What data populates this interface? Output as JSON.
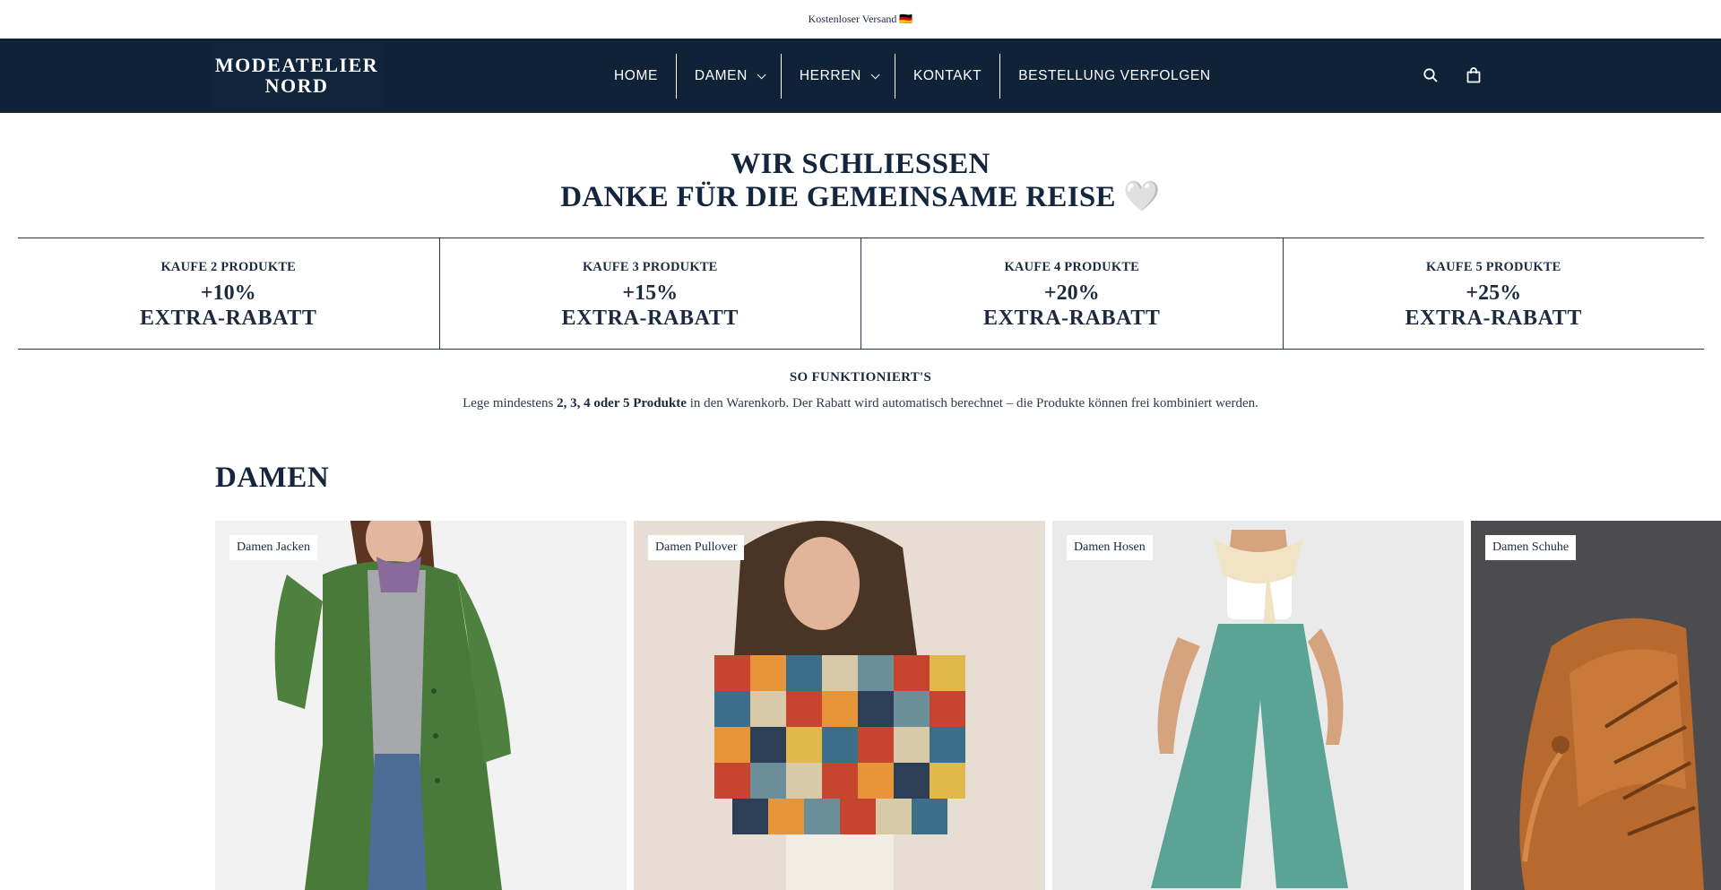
{
  "announcement": "Kostenloser Versand 🇩🇪",
  "brand": {
    "line1": "MODEATELIER",
    "line2": "NORD"
  },
  "nav": {
    "items": [
      {
        "label": "HOME",
        "dropdown": false
      },
      {
        "label": "DAMEN",
        "dropdown": true
      },
      {
        "label": "HERREN",
        "dropdown": true
      },
      {
        "label": "KONTAKT",
        "dropdown": false
      },
      {
        "label": "BESTELLUNG VERFOLGEN",
        "dropdown": false
      }
    ],
    "icons": [
      "search-icon",
      "cart-icon"
    ]
  },
  "hero": {
    "line1": "WIR SCHLIESSEN",
    "line2": "DANKE FÜR DIE GEMEINSAME REISE 🤍"
  },
  "tiers": [
    {
      "label": "KAUFE 2 PRODUKTE",
      "pct": "+10%",
      "extra": "EXTRA-RABATT"
    },
    {
      "label": "KAUFE 3 PRODUKTE",
      "pct": "+15%",
      "extra": "EXTRA-RABATT"
    },
    {
      "label": "KAUFE 4 PRODUKTE",
      "pct": "+20%",
      "extra": "EXTRA-RABATT"
    },
    {
      "label": "KAUFE 5 PRODUKTE",
      "pct": "+25%",
      "extra": "EXTRA-RABATT"
    }
  ],
  "how": {
    "title": "SO FUNKTIONIERT'S",
    "pre": "Lege mindestens ",
    "bold": "2, 3, 4 oder 5 Produkte",
    "post": " in den Warenkorb. Der Rabatt wird automatisch berechnet – die Produkte können frei kombiniert werden."
  },
  "section": {
    "title": "DAMEN"
  },
  "cards": [
    {
      "tag": "Damen Jacken"
    },
    {
      "tag": "Damen Pullover"
    },
    {
      "tag": "Damen Hosen"
    },
    {
      "tag": "Damen Schuhe"
    }
  ],
  "colors": {
    "nav_bg": "#0f2238",
    "text": "#1b2a3f"
  }
}
